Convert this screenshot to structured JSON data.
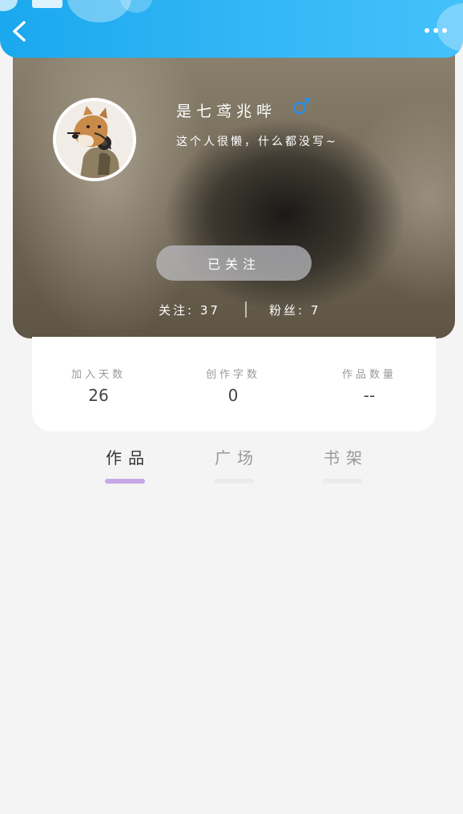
{
  "header": {
    "back_icon": "chevron-left-icon",
    "more_icon": "more-dots-icon",
    "colors": {
      "gradient_start": "#1aa8ee",
      "gradient_end": "#43c1fb"
    }
  },
  "profile": {
    "username": "是七鸢兆哔",
    "gender_symbol": "♂",
    "gender_color": "#2c8de3",
    "bio": "这个人很懒，什么都没写~",
    "follow_button_label": "已关注",
    "following_label": "关注: 37",
    "followers_label": "粉丝: 7"
  },
  "stats": [
    {
      "label": "加入天数",
      "value": "26"
    },
    {
      "label": "创作字数",
      "value": "0"
    },
    {
      "label": "作品数量",
      "value": "--"
    }
  ],
  "tabs": [
    {
      "label": "作品",
      "active": true
    },
    {
      "label": "广场",
      "active": false
    },
    {
      "label": "书架",
      "active": false
    }
  ],
  "colors": {
    "active_tab_indicator": "#c9a7e6",
    "inactive_tab_indicator": "#ebebeb",
    "page_background": "#f4f4f4"
  }
}
